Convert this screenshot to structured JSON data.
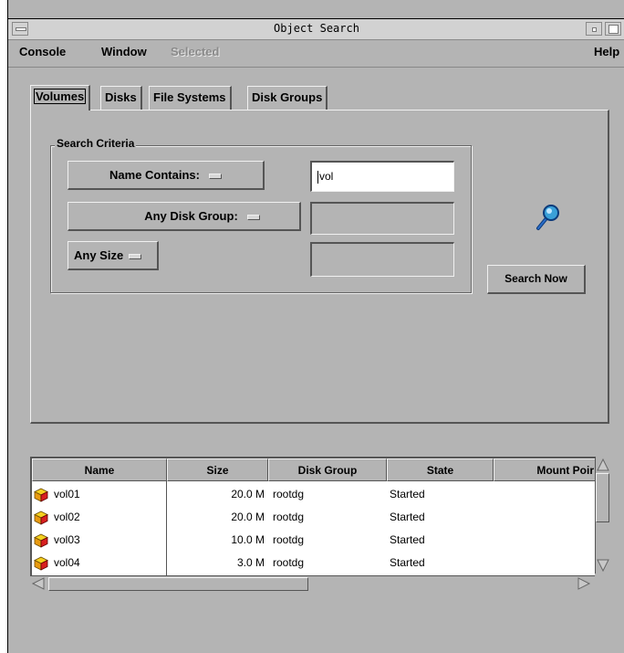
{
  "window": {
    "title": "Object Search"
  },
  "menu": {
    "console": "Console",
    "window": "Window",
    "selected": "Selected",
    "help": "Help"
  },
  "tabs": [
    {
      "label": "Volumes",
      "active": true
    },
    {
      "label": "Disks",
      "active": false
    },
    {
      "label": "File Systems",
      "active": false
    },
    {
      "label": "Disk Groups",
      "active": false
    }
  ],
  "criteria": {
    "legend": "Search Criteria",
    "name_option": "Name Contains:",
    "name_value": "vol",
    "group_option": "Any Disk Group:",
    "group_value": "",
    "size_option": "Any Size",
    "size_value": ""
  },
  "search": {
    "button_label": "Search Now",
    "icon": "magnifier-icon"
  },
  "table": {
    "columns": [
      "Name",
      "Size",
      "Disk Group",
      "State",
      "Mount Poir"
    ],
    "rows": [
      {
        "name": "vol01",
        "size": "20.0 M",
        "group": "rootdg",
        "state": "Started",
        "mount": ""
      },
      {
        "name": "vol02",
        "size": "20.0 M",
        "group": "rootdg",
        "state": "Started",
        "mount": ""
      },
      {
        "name": "vol03",
        "size": "10.0 M",
        "group": "rootdg",
        "state": "Started",
        "mount": ""
      },
      {
        "name": "vol04",
        "size": "3.0 M",
        "group": "rootdg",
        "state": "Started",
        "mount": ""
      }
    ],
    "row_icon": "volume-cube-icon"
  },
  "colors": {
    "background": "#b4b4b4",
    "highlight": "#f0f0f0",
    "shadow": "#555555",
    "table_bg": "#ffffff",
    "icon_yellow": "#f5d020",
    "icon_red": "#d82020",
    "magnifier_blue": "#2a8fc8"
  }
}
